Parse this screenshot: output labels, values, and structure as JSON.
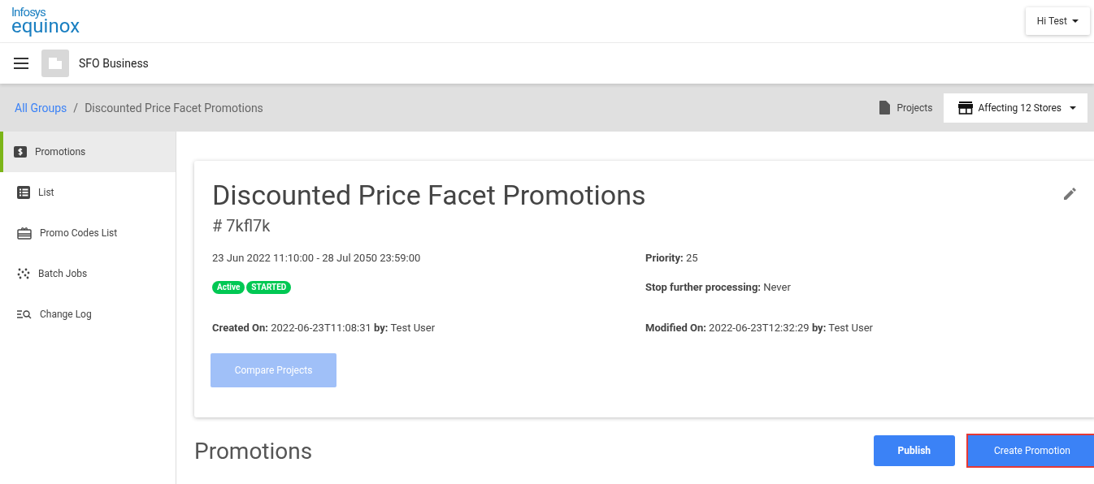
{
  "logo": {
    "line_1": "Infosys",
    "line_2": "equinox"
  },
  "user_menu": {
    "label": "Hi Test"
  },
  "business": {
    "name": "SFO Business"
  },
  "breadcrumb": [
    {
      "label": "All Groups",
      "kind": "link"
    },
    {
      "label": "Discounted Price Facet Promotions",
      "kind": "current"
    }
  ],
  "separator": "/",
  "projects_link": {
    "label": "Projects"
  },
  "stores_menu": {
    "label": "Affecting 12 Stores"
  },
  "sidebar": {
    "items": [
      {
        "label": "Promotions",
        "kind": "dollar",
        "selected": true
      },
      {
        "label": "List",
        "kind": "list",
        "selected": false
      },
      {
        "label": "Promo Codes List",
        "kind": "gift",
        "selected": false
      },
      {
        "label": "Batch Jobs",
        "kind": "dots",
        "selected": false
      },
      {
        "label": "Change Log",
        "kind": "log",
        "selected": false
      }
    ]
  },
  "card": {
    "title": "Discounted Price Facet Promotions",
    "code": "# 7kfl7k",
    "left": [
      {
        "kind": "text",
        "text": "23 Jun 2022 11:10:00 - 28 Jul 2050 23:59:00"
      },
      {
        "kind": "badges",
        "badges": [
          "Active",
          "STARTED"
        ]
      },
      {
        "kind": "text",
        "text": "**Created On:** 2022-06-23T11:08:31 **by:** Test User"
      }
    ],
    "right": [
      {
        "kind": "text",
        "text": "**Priority:** 25"
      },
      {
        "kind": "text",
        "text": "**Stop further processing:** Never"
      },
      {
        "kind": "text",
        "text": "**Modified On:** 2022-06-23T12:32:29 **by:** Test User"
      }
    ],
    "compare_button": {
      "label": "Compare Projects",
      "disabled": true
    }
  },
  "section": {
    "title": "Promotions"
  },
  "actions": [
    {
      "label": "Publish",
      "highlighted": false
    },
    {
      "label": "Create Promotion",
      "highlighted": true
    }
  ]
}
